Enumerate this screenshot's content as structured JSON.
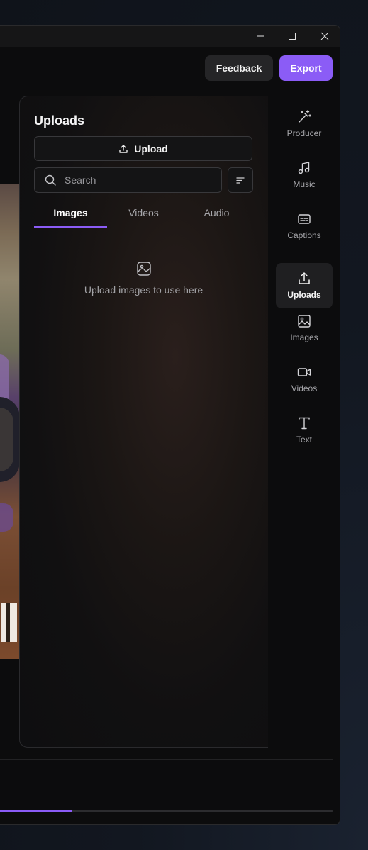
{
  "window": {
    "controls": {
      "minimize_icon": "minimize-icon",
      "maximize_icon": "maximize-icon",
      "close_icon": "close-icon"
    }
  },
  "header": {
    "feedback_label": "Feedback",
    "export_label": "Export"
  },
  "panel": {
    "title": "Uploads",
    "upload_label": "Upload",
    "search_placeholder": "Search",
    "tabs": [
      {
        "label": "Images",
        "active": true
      },
      {
        "label": "Videos",
        "active": false
      },
      {
        "label": "Audio",
        "active": false
      }
    ],
    "empty_message": "Upload images to use here"
  },
  "rail": {
    "items": [
      {
        "label": "Producer",
        "icon": "magic-wand-icon",
        "active": false
      },
      {
        "label": "Music",
        "icon": "music-note-icon",
        "active": false
      },
      {
        "label": "Captions",
        "icon": "captions-icon",
        "active": false
      },
      {
        "label": "Uploads",
        "icon": "upload-icon",
        "active": true
      },
      {
        "label": "Images",
        "icon": "image-icon",
        "active": false
      },
      {
        "label": "Videos",
        "icon": "video-camera-icon",
        "active": false
      },
      {
        "label": "Text",
        "icon": "text-icon",
        "active": false
      }
    ]
  },
  "timeline": {
    "progress": 0.22
  },
  "colors": {
    "accent": "#8b5cf6",
    "background": "#0c0c0d",
    "surface": "#141415"
  }
}
